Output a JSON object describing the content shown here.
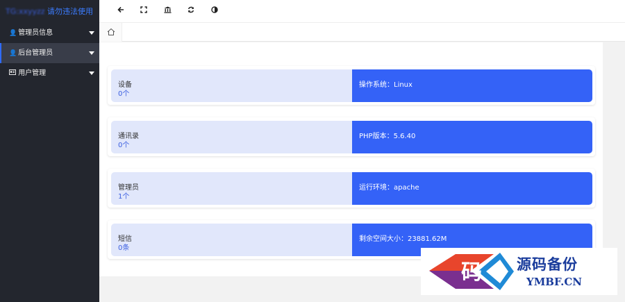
{
  "brand": {
    "blurred": "TG:xxyyzz",
    "title": "请勿违法使用"
  },
  "sidebar": {
    "items": [
      {
        "icon": "user-icon",
        "label": "管理员信息",
        "active": false
      },
      {
        "icon": "user-icon",
        "label": "后台管理员",
        "active": true
      },
      {
        "icon": "id-card-icon",
        "label": "用户管理",
        "active": false
      }
    ]
  },
  "topbar": {
    "buttons": [
      "back-arrow-icon",
      "fullscreen-icon",
      "bank-icon",
      "refresh-icon",
      "theme-icon"
    ]
  },
  "tabs": [
    {
      "icon": "home-icon"
    }
  ],
  "cards": [
    {
      "label": "设备",
      "count": "0个",
      "info": "操作系统：Linux"
    },
    {
      "label": "通讯录",
      "count": "0个",
      "info": "PHP版本：5.6.40"
    },
    {
      "label": "管理员",
      "count": "1个",
      "info": "运行环境：apache"
    },
    {
      "label": "短信",
      "count": "0条",
      "info": "剩余空间大小：23881.62M"
    }
  ],
  "watermark": {
    "title": "源码备份",
    "url": "YMBF.CN",
    "glyph": "码"
  },
  "colors": {
    "sidebar": "#23262e",
    "accent": "#3462f7",
    "card_left": "#e1e7fb"
  }
}
